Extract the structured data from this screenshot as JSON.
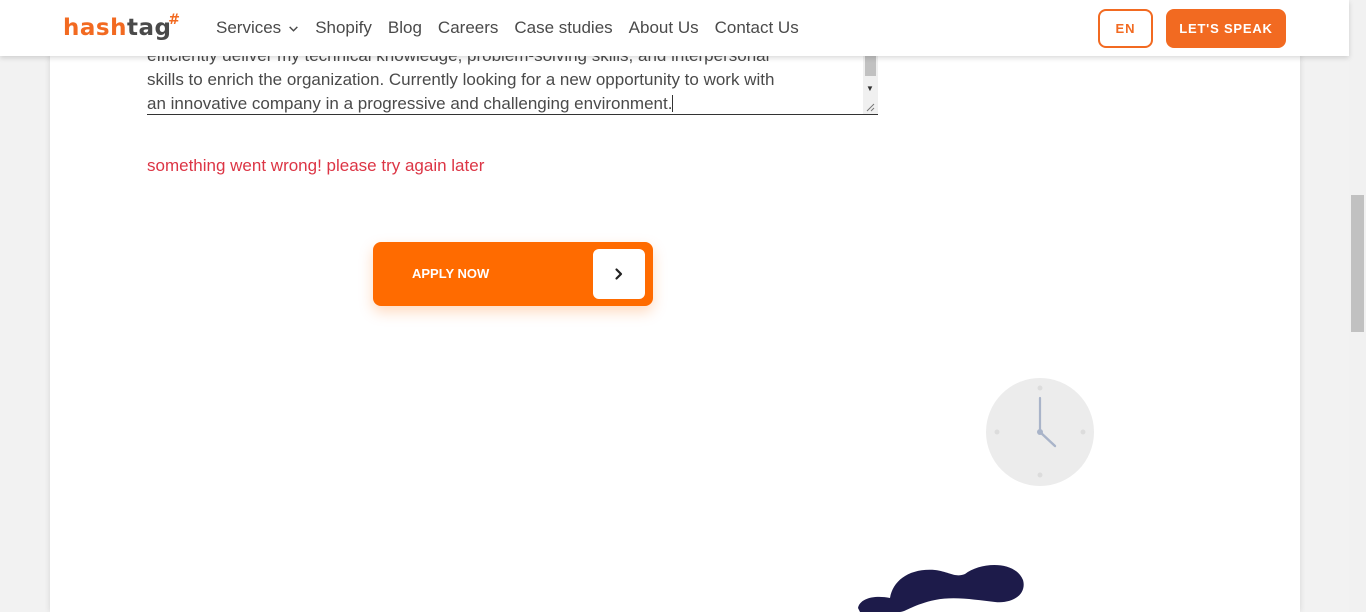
{
  "nav": {
    "logo_main": "hash",
    "logo_tail": "tag",
    "logo_mark": "#",
    "items": [
      {
        "label": "Services",
        "has_dropdown": true
      },
      {
        "label": "Shopify"
      },
      {
        "label": "Blog"
      },
      {
        "label": "Careers"
      },
      {
        "label": "Case studies"
      },
      {
        "label": "About Us"
      },
      {
        "label": "Contact Us"
      }
    ],
    "lang": "EN",
    "cta": "LET'S SPEAK"
  },
  "form": {
    "textarea_lines": [
      "efficiently deliver my technical knowledge, problem-solving skills, and interpersonal",
      "skills to enrich the organization. Currently looking for a new opportunity to work with",
      "an innovative company in a progressive and challenging environment."
    ],
    "error": "something went wrong! please try again later",
    "apply_label": "APPLY NOW"
  },
  "icons": {
    "dropdown": "chevron-down-icon",
    "apply_arrow": "chevron-right-icon",
    "clock": "clock-illustration",
    "blob": "blob-illustration"
  },
  "colors": {
    "brand_orange": "#f26a21",
    "button_orange": "#ff6b00",
    "error_red": "#dc3545",
    "text_dark": "#4a4a4a",
    "navy": "#1d1b4a"
  }
}
